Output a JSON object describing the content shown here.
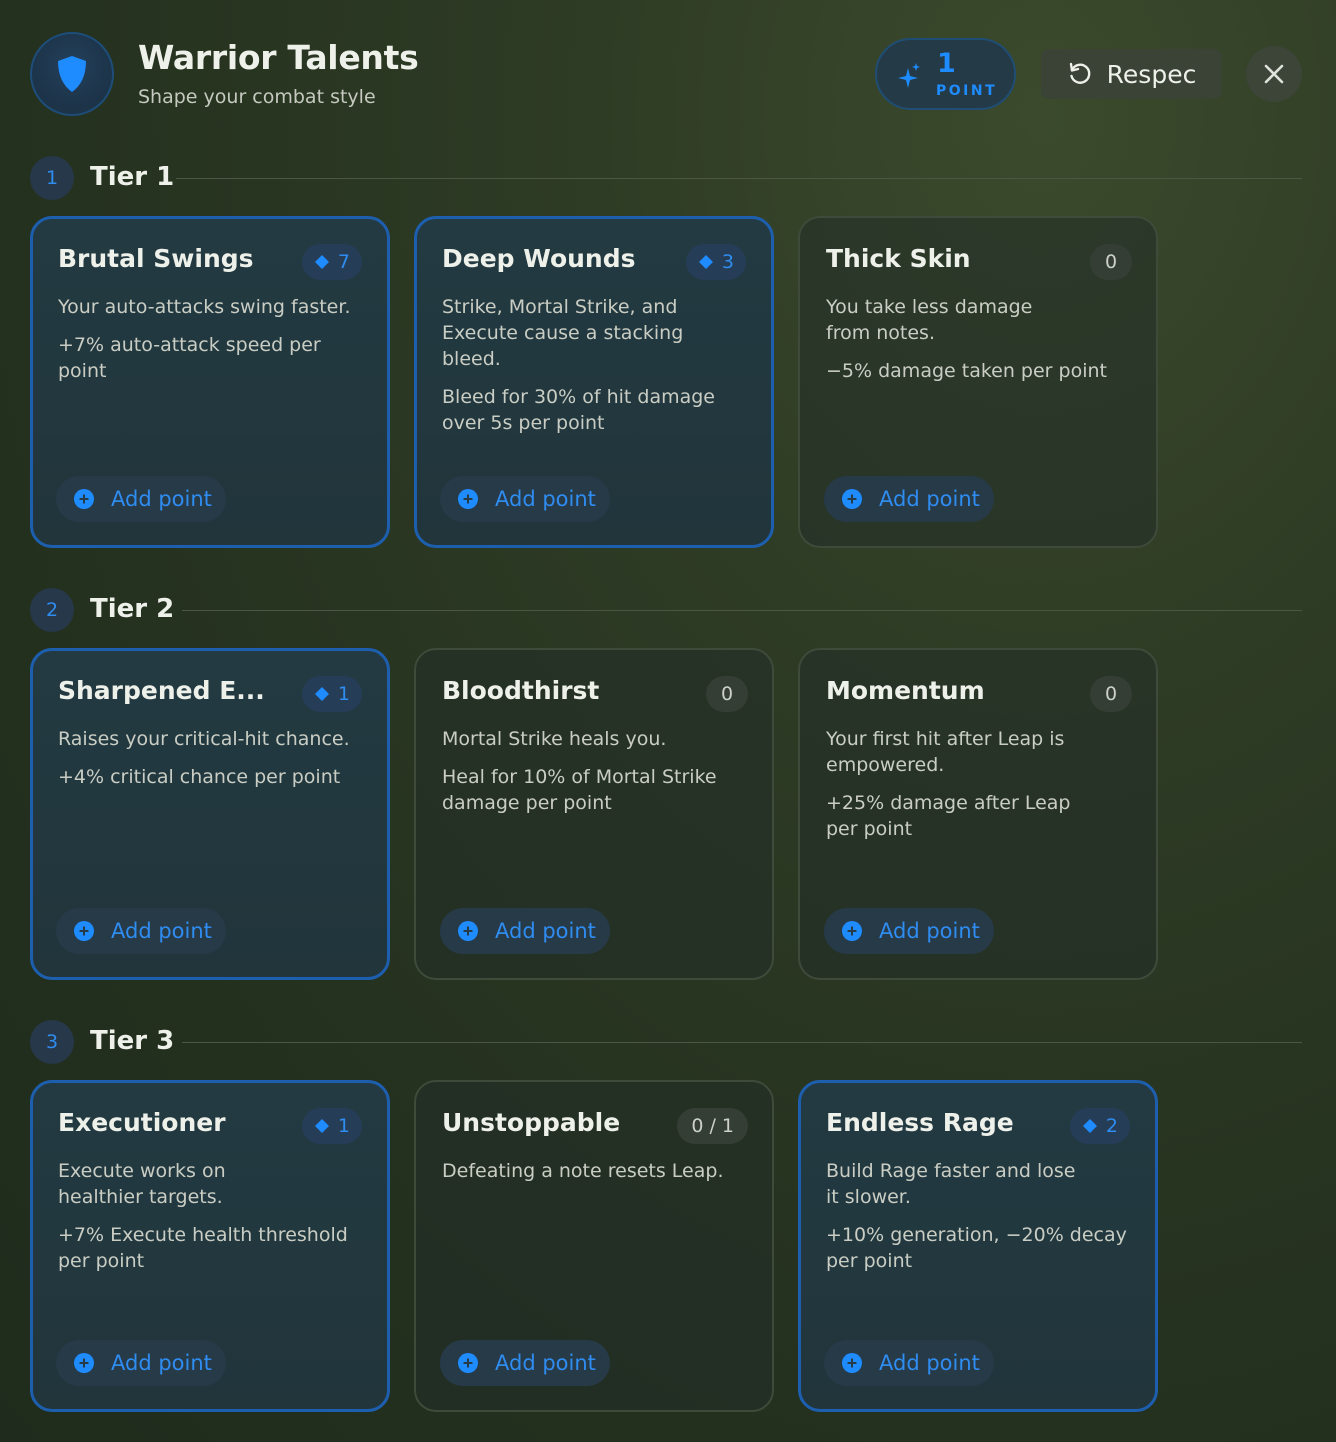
{
  "header": {
    "title": "Warrior Talents",
    "subtitle": "Shape your combat style",
    "points_value": "1",
    "points_label": "POINT",
    "respec_label": "Respec"
  },
  "colors": {
    "accent": "#1e8cff",
    "active_border": "#1d5fae",
    "background": "#2a3722"
  },
  "icons": {
    "logo": "shield-icon",
    "points": "sparkle-icon",
    "respec": "rotate-ccw-icon",
    "close": "close-icon",
    "add": "plus-circle-icon",
    "badge": "diamond-icon"
  },
  "tiers": [
    {
      "number": "1",
      "title": "Tier 1",
      "talents": [
        {
          "name": "Brutal Swings",
          "badge": "7",
          "desc": "Your auto-attacks swing faster.",
          "effect": "+7% auto-attack speed per point",
          "action": "Add point"
        },
        {
          "name": "Deep Wounds",
          "badge": "3",
          "desc": "Strike, Mortal Strike, and Execute cause a stacking bleed.",
          "effect": "Bleed for 30% of hit damage over 5s per point",
          "action": "Add point"
        },
        {
          "name": "Thick Skin",
          "badge": "0",
          "desc": "You take less damage from notes.",
          "effect": "−5% damage taken per point",
          "action": "Add point"
        }
      ]
    },
    {
      "number": "2",
      "title": "Tier 2",
      "talents": [
        {
          "name": "Sharpened E...",
          "badge": "1",
          "desc": "Raises your critical-hit chance.",
          "effect": "+4% critical chance per point",
          "action": "Add point"
        },
        {
          "name": "Bloodthirst",
          "badge": "0",
          "desc": "Mortal Strike heals you.",
          "effect": "Heal for 10% of Mortal Strike damage per point",
          "action": "Add point"
        },
        {
          "name": "Momentum",
          "badge": "0",
          "desc": "Your first hit after Leap is empowered.",
          "effect": "+25% damage after Leap per point",
          "action": "Add point"
        }
      ]
    },
    {
      "number": "3",
      "title": "Tier 3",
      "talents": [
        {
          "name": "Executioner",
          "badge": "1",
          "desc": "Execute works on healthier targets.",
          "effect": "+7% Execute health threshold per point",
          "action": "Add point"
        },
        {
          "name": "Unstoppable",
          "badge": "0 / 1",
          "desc": "Defeating a note resets Leap.",
          "action": "Add point"
        },
        {
          "name": "Endless Rage",
          "badge": "2",
          "desc": "Build Rage faster and lose it slower.",
          "effect": "+10% generation, −20% decay per point",
          "action": "Add point"
        }
      ]
    }
  ]
}
